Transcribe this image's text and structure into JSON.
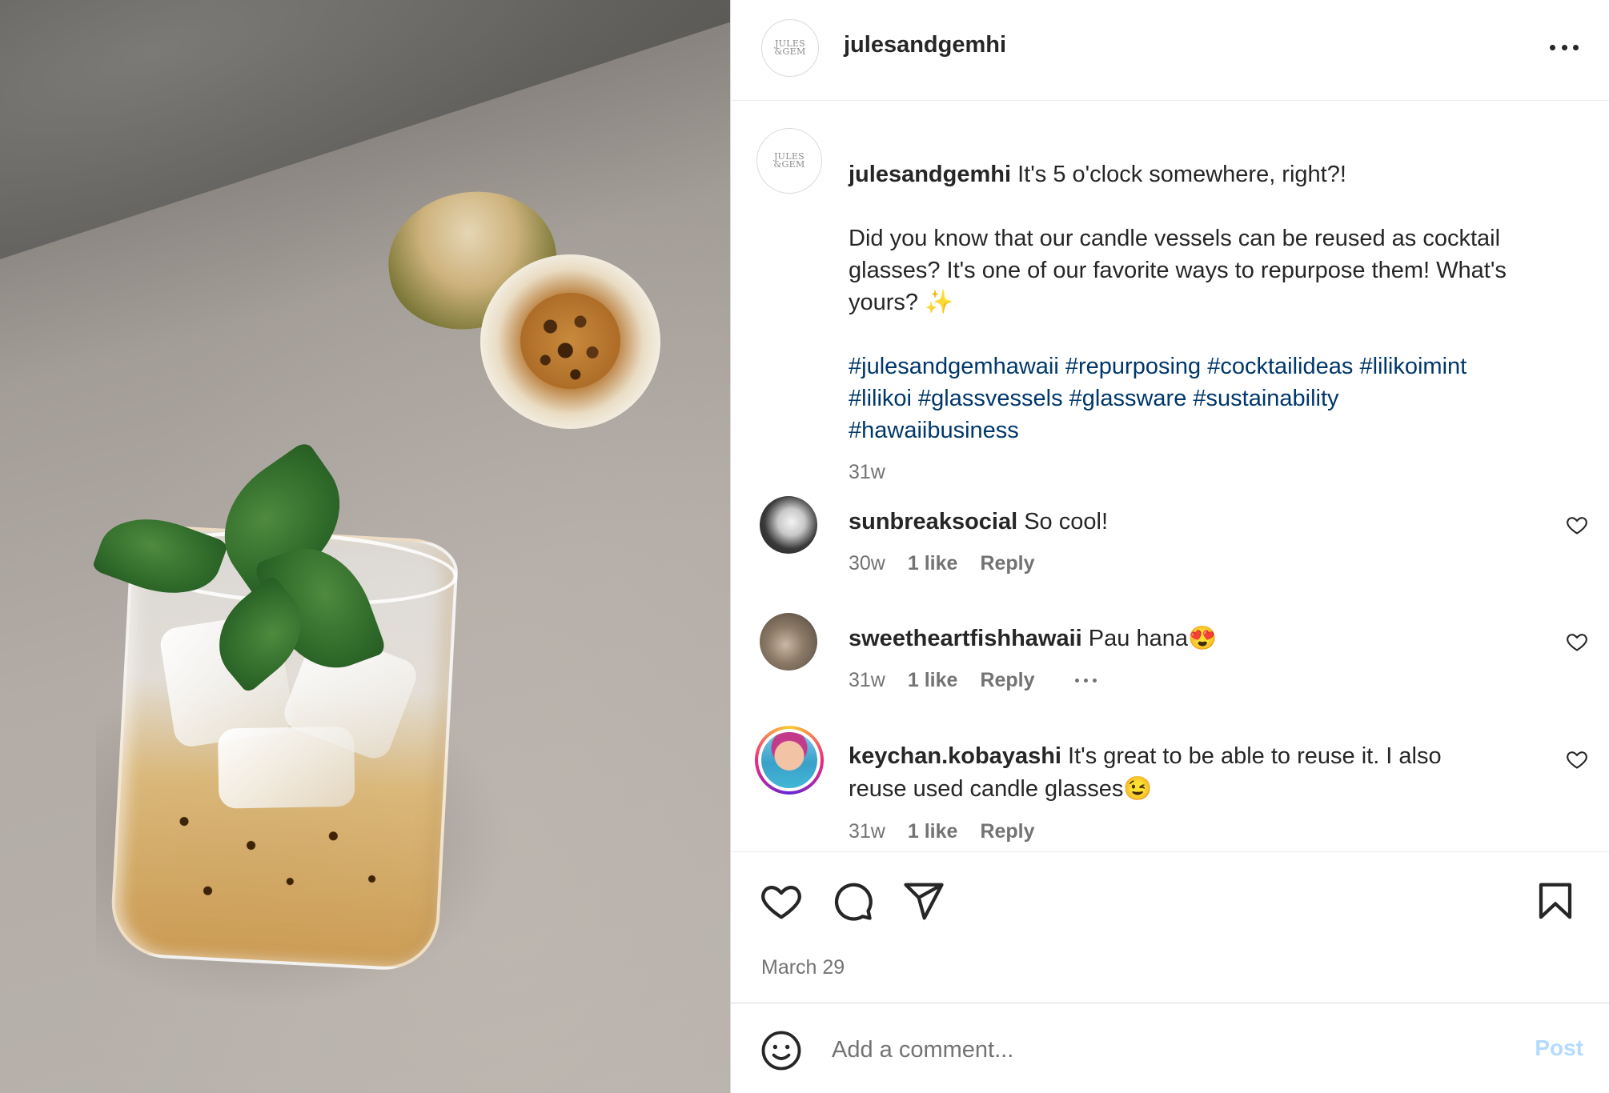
{
  "header": {
    "username": "julesandgemhi",
    "brand_logo_text": "JULES & GEM"
  },
  "caption": {
    "username": "julesandgemhi",
    "text_line1": "It's 5 o'clock somewhere, right?!",
    "text_para2": "Did you know that our candle vessels can be reused as cocktail glasses? It's one of our favorite ways to repurpose them! What's yours? ✨",
    "hashtags": [
      "#julesandgemhawaii",
      "#repurposing",
      "#cocktailideas",
      "#lilikoimint",
      "#lilikoi",
      "#glassvessels",
      "#glassware",
      "#sustainability",
      "#hawaiibusiness"
    ],
    "time": "31w"
  },
  "comments": [
    {
      "username": "sunbreaksocial",
      "text": "So cool!",
      "time": "30w",
      "likes": "1 like",
      "reply": "Reply"
    },
    {
      "username": "sweetheartfishhawaii",
      "text": "Pau hana😍",
      "time": "31w",
      "likes": "1 like",
      "reply": "Reply"
    },
    {
      "username": "keychan.kobayashi",
      "text": "It's great to be able to reuse it. I also reuse used candle glasses😉",
      "time": "31w",
      "likes": "1 like",
      "reply": "Reply"
    }
  ],
  "actions": {
    "icons": [
      "heart-icon",
      "comment-icon",
      "share-icon",
      "bookmark-icon"
    ],
    "date": "March 29"
  },
  "comment_box": {
    "placeholder": "Add a comment...",
    "post_label": "Post",
    "post_color": "#b3dbff"
  },
  "colors": {
    "text": "#262626",
    "secondary": "#737373",
    "hashtag": "#00376b"
  }
}
